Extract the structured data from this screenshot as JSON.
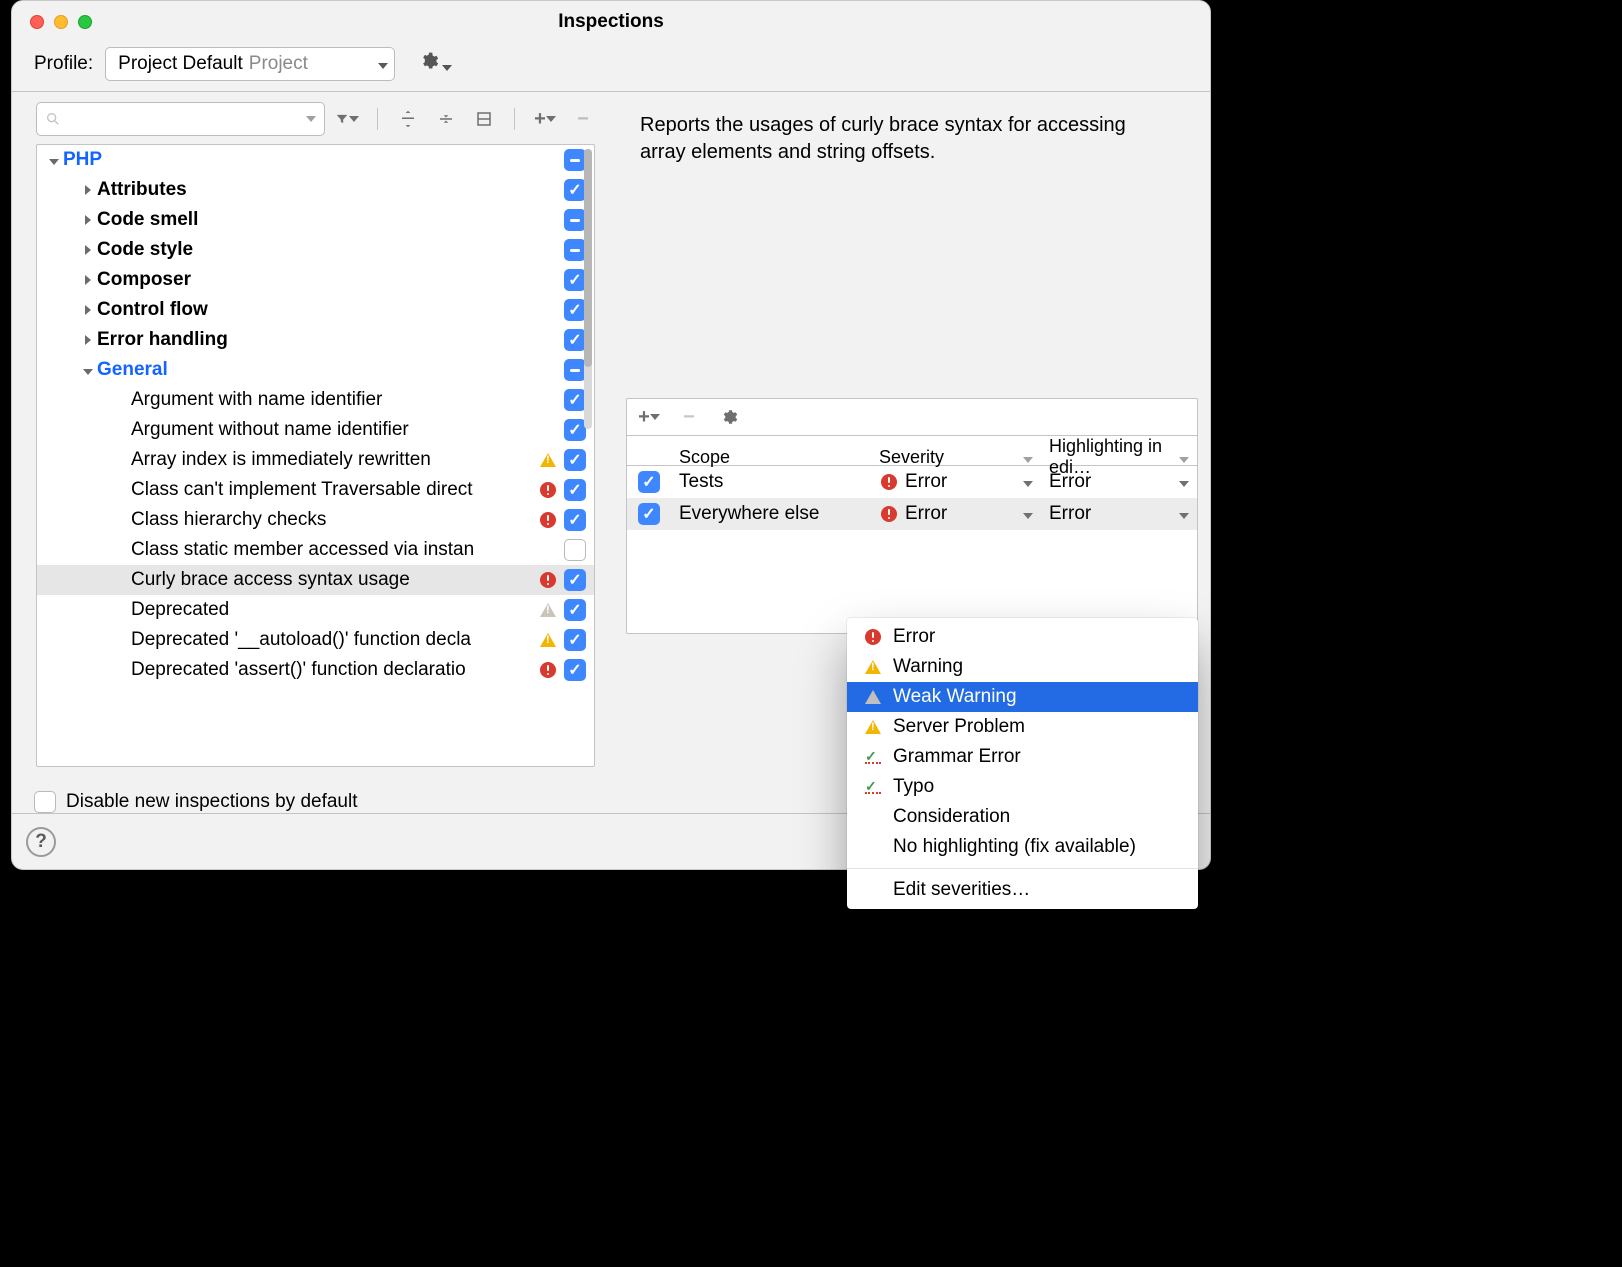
{
  "window": {
    "title": "Inspections"
  },
  "profile": {
    "label": "Profile:",
    "value": "Project Default",
    "suffix": "Project"
  },
  "search": {
    "placeholder": ""
  },
  "tree": [
    {
      "indent": 0,
      "arrow": "down",
      "label": "PHP",
      "cls": "blue",
      "check": "mixed"
    },
    {
      "indent": 1,
      "arrow": "right",
      "label": "Attributes",
      "cls": "bold",
      "check": "on"
    },
    {
      "indent": 1,
      "arrow": "right",
      "label": "Code smell",
      "cls": "bold",
      "check": "mixed"
    },
    {
      "indent": 1,
      "arrow": "right",
      "label": "Code style",
      "cls": "bold",
      "check": "mixed"
    },
    {
      "indent": 1,
      "arrow": "right",
      "label": "Composer",
      "cls": "bold",
      "check": "on"
    },
    {
      "indent": 1,
      "arrow": "right",
      "label": "Control flow",
      "cls": "bold",
      "check": "on"
    },
    {
      "indent": 1,
      "arrow": "right",
      "label": "Error handling",
      "cls": "bold",
      "check": "on"
    },
    {
      "indent": 1,
      "arrow": "down",
      "label": "General",
      "cls": "blue",
      "check": "mixed"
    },
    {
      "indent": 2,
      "arrow": "",
      "label": "Argument with name identifier",
      "check": "on"
    },
    {
      "indent": 2,
      "arrow": "",
      "label": "Argument without name identifier",
      "check": "on"
    },
    {
      "indent": 2,
      "arrow": "",
      "label": "Array index is immediately rewritten",
      "check": "on",
      "status": "warn"
    },
    {
      "indent": 2,
      "arrow": "",
      "label": "Class can't implement Traversable direct",
      "check": "on",
      "status": "err"
    },
    {
      "indent": 2,
      "arrow": "",
      "label": "Class hierarchy checks",
      "check": "on",
      "status": "err"
    },
    {
      "indent": 2,
      "arrow": "",
      "label": "Class static member accessed via instan",
      "check": "off"
    },
    {
      "indent": 2,
      "arrow": "",
      "label": "Curly brace access syntax usage",
      "check": "on",
      "status": "err",
      "selected": true
    },
    {
      "indent": 2,
      "arrow": "",
      "label": "Deprecated",
      "check": "on",
      "status": "warn_grey"
    },
    {
      "indent": 2,
      "arrow": "",
      "label": "Deprecated '__autoload()' function decla",
      "check": "on",
      "status": "warn"
    },
    {
      "indent": 2,
      "arrow": "",
      "label": "Deprecated 'assert()' function declaratio",
      "check": "on",
      "status": "err"
    }
  ],
  "description": "Reports the usages of curly brace syntax for accessing array elements and string offsets.",
  "sev": {
    "headers": {
      "scope": "Scope",
      "severity": "Severity",
      "highlight": "Highlighting in edi…"
    },
    "rows": [
      {
        "scope": "Tests",
        "severity": "Error",
        "highlight": "Error",
        "checked": true
      },
      {
        "scope": "Everywhere else",
        "severity": "Error",
        "highlight": "Error",
        "checked": true,
        "selected": true
      }
    ]
  },
  "popup": {
    "groups": [
      [
        {
          "label": "Error",
          "icon": "err"
        },
        {
          "label": "Warning",
          "icon": "warn"
        },
        {
          "label": "Weak Warning",
          "icon": "ww",
          "selected": true
        },
        {
          "label": "Server Problem",
          "icon": "warn"
        },
        {
          "label": "Grammar Error",
          "icon": "typo"
        },
        {
          "label": "Typo",
          "icon": "typo"
        },
        {
          "label": "Consideration",
          "icon": ""
        },
        {
          "label": "No highlighting (fix available)",
          "icon": ""
        }
      ],
      [
        {
          "label": "Edit severities…",
          "icon": ""
        }
      ]
    ]
  },
  "footer": {
    "disable_label": "Disable new inspections by default"
  }
}
